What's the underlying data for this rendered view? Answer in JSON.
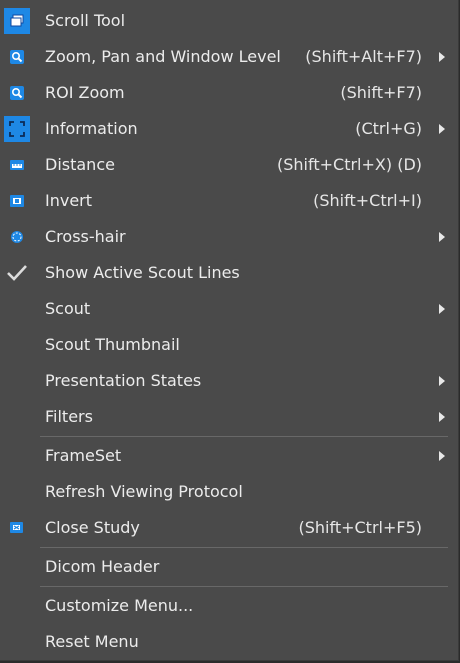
{
  "menu": {
    "items": [
      {
        "label": "Scroll Tool",
        "shortcut": "",
        "icon": "scroll-tool-icon"
      },
      {
        "label": "Zoom, Pan and Window Level",
        "shortcut": "(Shift+Alt+F7)",
        "icon": "zoom-pan-icon"
      },
      {
        "label": "ROI Zoom",
        "shortcut": "(Shift+F7)",
        "icon": "roi-zoom-icon"
      },
      {
        "label": "Information",
        "shortcut": "(Ctrl+G)",
        "icon": "information-icon"
      },
      {
        "label": "Distance",
        "shortcut": "(Shift+Ctrl+X) (D)",
        "icon": "distance-icon"
      },
      {
        "label": "Invert",
        "shortcut": "(Shift+Ctrl+I)",
        "icon": "invert-icon"
      },
      {
        "label": "Cross-hair",
        "shortcut": "",
        "icon": "cross-hair-icon"
      },
      {
        "label": "Show Active Scout Lines",
        "shortcut": "",
        "icon": "checkmark-icon"
      },
      {
        "label": "Scout",
        "shortcut": ""
      },
      {
        "label": "Scout Thumbnail",
        "shortcut": ""
      },
      {
        "label": "Presentation States",
        "shortcut": ""
      },
      {
        "label": "Filters",
        "shortcut": ""
      },
      {
        "label": "FrameSet",
        "shortcut": ""
      },
      {
        "label": "Refresh Viewing Protocol",
        "shortcut": ""
      },
      {
        "label": "Close Study",
        "shortcut": "(Shift+Ctrl+F5)",
        "icon": "close-study-icon"
      },
      {
        "label": "Dicom Header",
        "shortcut": ""
      },
      {
        "label": "Customize Menu...",
        "shortcut": ""
      },
      {
        "label": "Reset Menu",
        "shortcut": ""
      }
    ]
  },
  "colors": {
    "menu_background": "#4a4a4a",
    "active_icon_background": "#1e88e5",
    "separator": "#686868",
    "text": "#ececec"
  }
}
